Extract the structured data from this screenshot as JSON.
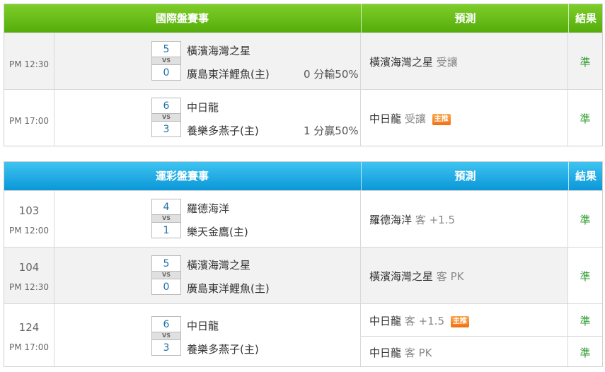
{
  "international": {
    "header": {
      "event": "國際盤賽事",
      "prediction": "預測",
      "result": "結果"
    },
    "rows": [
      {
        "time": "PM 12:30",
        "team1": "橫濱海灣之星",
        "score1": "5",
        "vs": "VS",
        "team2": "廣島東洋鯉魚(主)",
        "score2": "0",
        "handicap": "0 分輸50%",
        "prediction_team": "橫濱海灣之星",
        "prediction_type": "受讓",
        "badge": "",
        "result": "準"
      },
      {
        "time": "PM 17:00",
        "team1": "中日龍",
        "score1": "6",
        "vs": "VS",
        "team2": "養樂多燕子(主)",
        "score2": "3",
        "handicap": "1 分贏50%",
        "prediction_team": "中日龍",
        "prediction_type": "受讓",
        "badge": "主推",
        "result": "準"
      }
    ]
  },
  "sports_lottery": {
    "header": {
      "event": "運彩盤賽事",
      "prediction": "預測",
      "result": "結果"
    },
    "rows": [
      {
        "num": "103",
        "time": "PM 12:00",
        "team1": "羅德海洋",
        "score1": "4",
        "vs": "VS",
        "team2": "樂天金鷹(主)",
        "score2": "1",
        "prediction_team": "羅德海洋",
        "prediction_type": "客 +1.5",
        "badge": "",
        "result": "準"
      },
      {
        "num": "104",
        "time": "PM 12:30",
        "team1": "橫濱海灣之星",
        "score1": "5",
        "vs": "VS",
        "team2": "廣島東洋鯉魚(主)",
        "score2": "0",
        "prediction_team": "橫濱海灣之星",
        "prediction_type": "客 PK",
        "badge": "",
        "result": "準"
      },
      {
        "num": "124",
        "time": "PM 17:00",
        "team1": "中日龍",
        "score1": "6",
        "vs": "VS",
        "team2": "養樂多燕子(主)",
        "score2": "3",
        "predictions": [
          {
            "team": "中日龍",
            "type": "客 +1.5",
            "badge": "主推",
            "result": "準"
          },
          {
            "team": "中日龍",
            "type": "客 PK",
            "badge": "",
            "result": "準"
          }
        ]
      }
    ]
  },
  "colors": {
    "green_header": "#6cc01a",
    "blue_header": "#22aee6",
    "result_text": "#2e9a2e",
    "badge": "#f58a2a",
    "score_text": "#1f6fa8"
  }
}
